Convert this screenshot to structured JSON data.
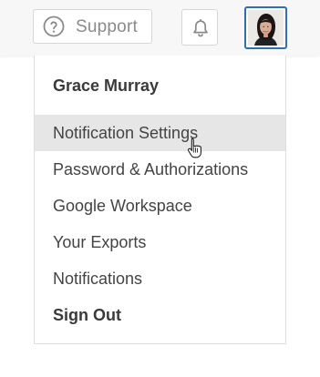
{
  "header": {
    "support_label": "Support",
    "support_icon": "question-circle-icon",
    "notification_icon": "bell-icon",
    "avatar_icon": "user-avatar"
  },
  "menu": {
    "user_name": "Grace Murray",
    "items": [
      {
        "label": "Notification Settings",
        "state": "hovered"
      },
      {
        "label": "Password & Authorizations",
        "state": "normal"
      },
      {
        "label": "Google Workspace",
        "state": "normal"
      },
      {
        "label": "Your Exports",
        "state": "normal"
      },
      {
        "label": "Notifications",
        "state": "normal"
      },
      {
        "label": "Sign Out",
        "state": "emphasized"
      }
    ]
  },
  "colors": {
    "avatar_border": "#2f6fb2",
    "hover_background": "#e6e6e6",
    "text": "#444444"
  }
}
